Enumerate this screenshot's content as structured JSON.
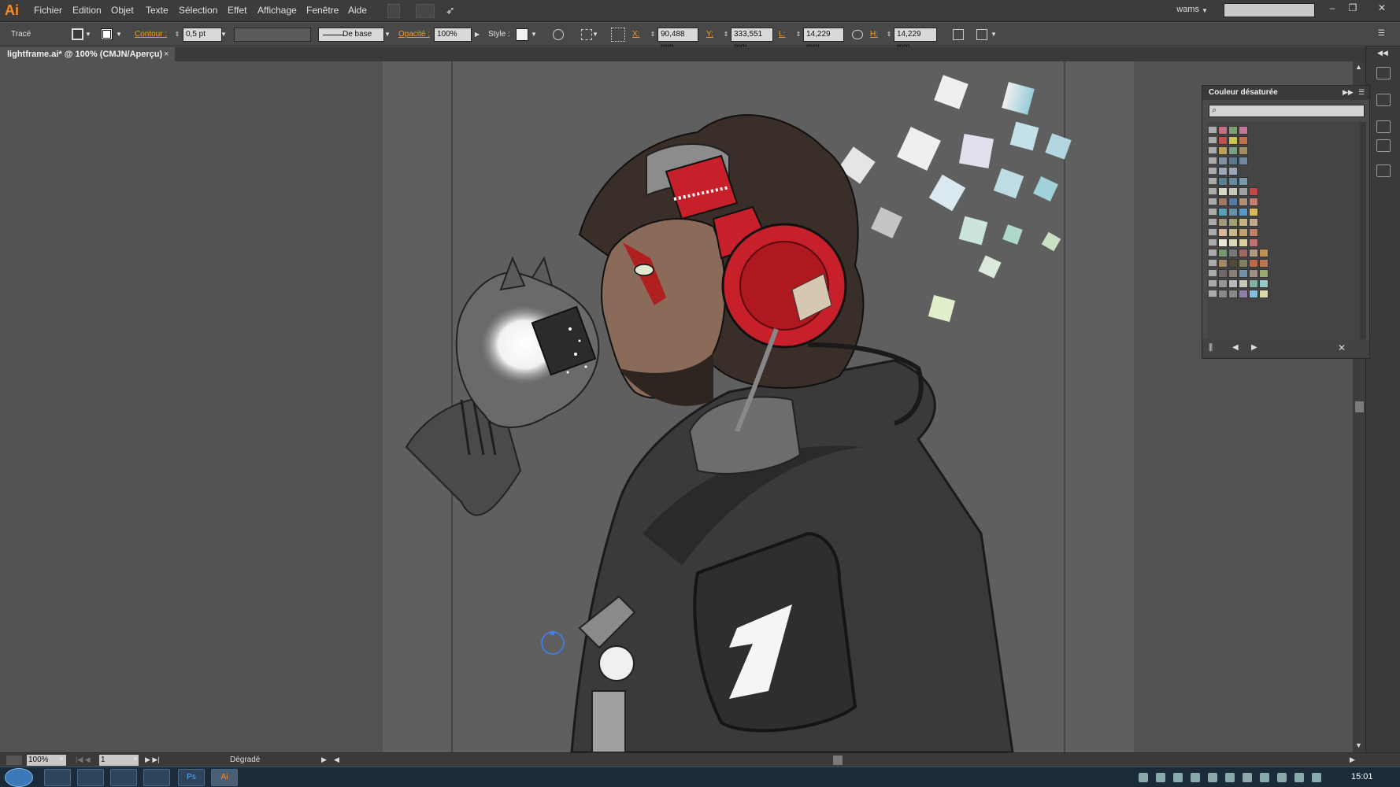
{
  "app": {
    "logo": "Ai"
  },
  "menu": [
    "Fichier",
    "Edition",
    "Objet",
    "Texte",
    "Sélection",
    "Effet",
    "Affichage",
    "Fenêtre",
    "Aide"
  ],
  "workspace": "wams",
  "control": {
    "mode": "Tracé",
    "contour_label": "Contour :",
    "contour_value": "0,5 pt",
    "brush_label": "De base",
    "opacity_label": "Opacité :",
    "opacity_value": "100%",
    "style_label": "Style :",
    "x_label": "X:",
    "x_value": "90,488 mm",
    "y_label": "Y:",
    "y_value": "333,551 mm",
    "w_label": "L:",
    "w_value": "14,229 mm",
    "h_label": "H:",
    "h_value": "14,229 mm"
  },
  "document": {
    "tab": "lightframe.ai* @ 100% (CMJN/Aperçu)",
    "close": "×"
  },
  "swatch_panel": {
    "title": "Couleur désaturée",
    "rows": [
      [
        "#c07080",
        "#7aa070",
        "#c07a98"
      ],
      [
        "#c05050",
        "#c8c850",
        "#c07050"
      ],
      [
        "#c0a058",
        "#78a080",
        "#a09060"
      ],
      [
        "#8090a0",
        "#5a7890",
        "#7088a0"
      ],
      [
        "#9aa8b8",
        "#9aa8b8"
      ],
      [
        "#5a8090",
        "#6888a0",
        "#7898a8"
      ],
      [
        "#d8d8c8",
        "#c8c8b8",
        "#a0a0a0",
        "#c04848"
      ],
      [
        "#a07868",
        "#5878a8",
        "#b09078",
        "#c08070"
      ],
      [
        "#58a0b8",
        "#6890a8",
        "#5898c8",
        "#d8b858"
      ],
      [
        "#a09878",
        "#a0a070",
        "#c8b080",
        "#c0a888"
      ],
      [
        "#d8b898",
        "#c8b888",
        "#c0a070",
        "#c08068"
      ],
      [
        "#e8e8d8",
        "#d8d8b8",
        "#d8d0a0",
        "#c07070"
      ],
      [
        "#7a9870",
        "#787878",
        "#a06860",
        "#b09880",
        "#c09050"
      ],
      [
        "#a08868",
        "#504838",
        "#808060",
        "#c06848",
        "#b87850"
      ],
      [
        "#706868",
        "#888078",
        "#7090a8",
        "#a09088",
        "#98a870"
      ],
      [
        "#909890",
        "#b8b8b8",
        "#c8c8b8",
        "#80b0a0",
        "#98c8c8"
      ],
      [
        "#888888",
        "#888888",
        "#9080a8",
        "#80c0d8",
        "#e0d8a8"
      ]
    ]
  },
  "status": {
    "zoom": "100%",
    "page": "1",
    "tool": "Dégradé"
  },
  "taskbar": {
    "clock": "15:01",
    "ps_label": "Ps",
    "ai_label": "Ai"
  },
  "colors": {
    "accent": "#f39a2b",
    "headphone_red": "#c8202a"
  }
}
